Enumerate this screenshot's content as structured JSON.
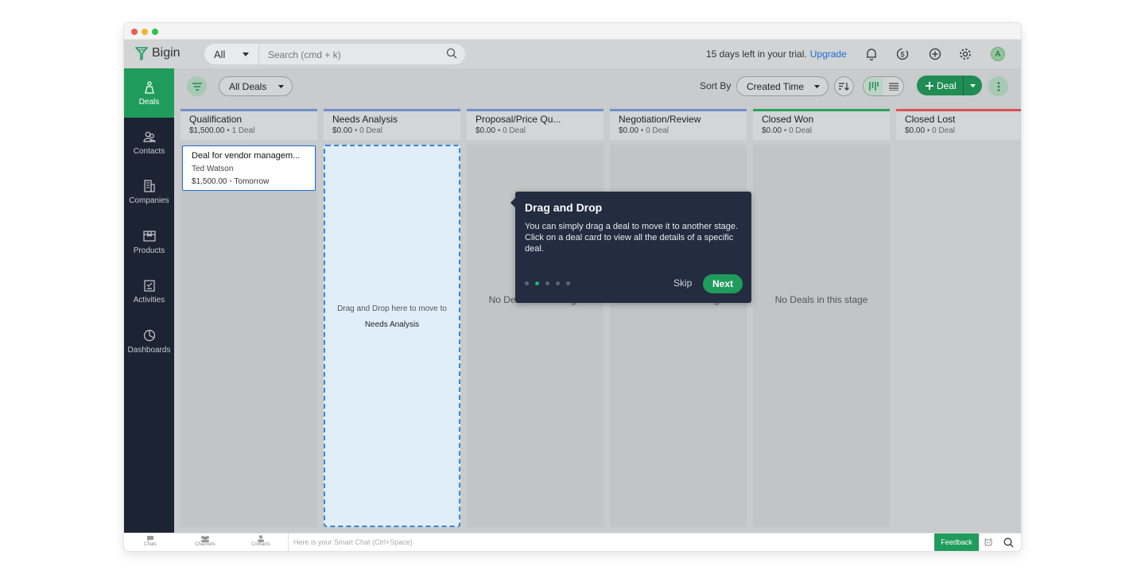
{
  "app": {
    "name": "Bigin"
  },
  "header": {
    "scope": "All",
    "search_placeholder": "Search (cmd + k)",
    "trial_text": "15 days left in your trial.",
    "upgrade": "Upgrade",
    "avatar_initial": "A"
  },
  "sidebar": {
    "items": [
      {
        "label": "Deals",
        "icon": "deals-icon"
      },
      {
        "label": "Contacts",
        "icon": "contacts-icon"
      },
      {
        "label": "Companies",
        "icon": "companies-icon"
      },
      {
        "label": "Products",
        "icon": "products-icon"
      },
      {
        "label": "Activities",
        "icon": "activities-icon"
      },
      {
        "label": "Dashboards",
        "icon": "dashboards-icon"
      }
    ]
  },
  "toolbar": {
    "view": "All Deals",
    "sort_by_label": "Sort By",
    "sort_field": "Created Time",
    "deal_button": "Deal"
  },
  "stages": [
    {
      "name": "Qualification",
      "amount": "$1,500.00",
      "count": "1 Deal",
      "color": "#6f8fc9"
    },
    {
      "name": "Needs Analysis",
      "amount": "$0.00",
      "count": "0 Deal",
      "color": "#6f8fc9"
    },
    {
      "name": "Proposal/Price Qu...",
      "amount": "$0.00",
      "count": "0 Deal",
      "color": "#6f8fc9"
    },
    {
      "name": "Negotiation/Review",
      "amount": "$0.00",
      "count": "0 Deal",
      "color": "#6f8fc9"
    },
    {
      "name": "Closed Won",
      "amount": "$0.00",
      "count": "0 Deal",
      "color": "#2fa060"
    },
    {
      "name": "Closed Lost",
      "amount": "$0.00",
      "count": "0 Deal",
      "color": "#d9534f"
    }
  ],
  "deal_card": {
    "title": "Deal for vendor managem...",
    "contact": "Ted Watson",
    "amount": "$1,500.00",
    "due": "Tomorrow"
  },
  "empty_stage_text": "No Deals in this stage",
  "drop_zone": {
    "hint": "Drag and Drop here to move to",
    "target": "Needs Analysis"
  },
  "tooltip": {
    "title": "Drag and Drop",
    "body": "You can simply drag a deal to move it to another stage. Click on a deal card to view all the details of a specific deal.",
    "skip": "Skip",
    "next": "Next",
    "step_current": 2,
    "step_total": 5
  },
  "bottom_bar": {
    "chats": "Chats",
    "channels": "Channels",
    "contacts": "Contacts",
    "chat_placeholder": "Here is your Smart Chat (Ctrl+Space)",
    "feedback": "Feedback"
  }
}
